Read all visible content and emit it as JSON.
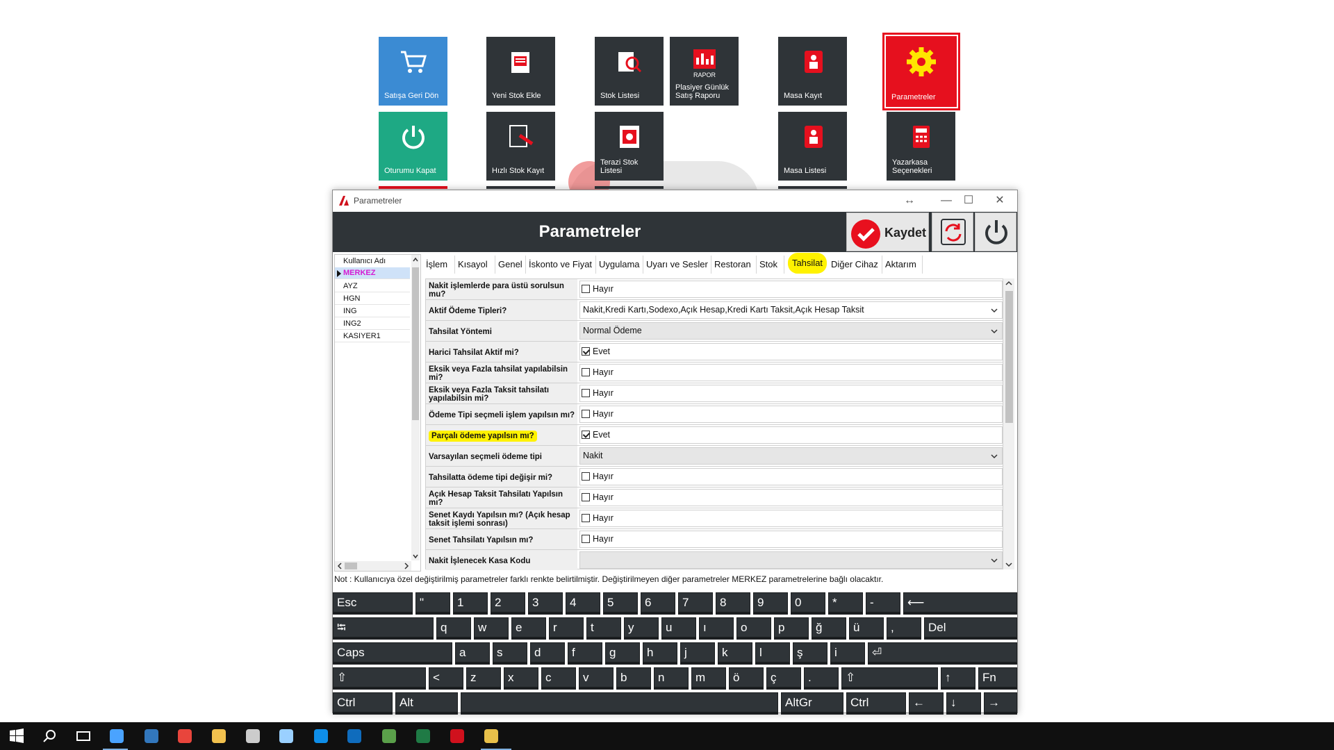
{
  "tiles": [
    {
      "label": "Satışa Geri Dön",
      "icon": "cart-icon"
    },
    {
      "label": "Yeni Stok Ekle",
      "icon": "new-stock-icon"
    },
    {
      "label": "Stok Listesi",
      "icon": "stock-search-icon"
    },
    {
      "label": "Plasiyer Günlük Satış Raporu",
      "icon": "report-icon",
      "badge": "RAPOR"
    },
    {
      "label": "Masa Kayıt",
      "icon": "table-register-icon"
    },
    {
      "label": "Parametreler",
      "icon": "gear-icon"
    },
    {
      "label": "Oturumu Kapat",
      "icon": "logout-icon"
    },
    {
      "label": "Hızlı Stok Kayıt",
      "icon": "quick-stock-icon"
    },
    {
      "label": "Terazi Stok Listesi",
      "icon": "scale-stock-icon"
    },
    {
      "label": "Masa Listesi",
      "icon": "table-list-icon"
    },
    {
      "label": "Yazarkasa Seçenekleri",
      "icon": "cash-register-icon"
    }
  ],
  "window": {
    "title": "Parametreler",
    "header_title": "Parametreler",
    "save_label": "Kaydet"
  },
  "users": {
    "header": "Kullanıcı Adı",
    "items": [
      "MERKEZ",
      "AYZ",
      "HGN",
      "ING",
      "ING2",
      "KASIYER1"
    ],
    "selected": "MERKEZ"
  },
  "tabs": [
    {
      "label": "İşlem"
    },
    {
      "label": "Kısayol"
    },
    {
      "label": "Genel"
    },
    {
      "label": "İskonto ve Fiyat"
    },
    {
      "label": "Uygulama"
    },
    {
      "label": "Uyarı ve Sesler"
    },
    {
      "label": "Restoran"
    },
    {
      "label": "Stok"
    },
    {
      "label": "Tahsilat",
      "active": true
    },
    {
      "label": "Diğer Cihaz"
    },
    {
      "label": "Aktarım"
    }
  ],
  "params": [
    {
      "label": "Nakit işlemlerde para üstü sorulsun mu?",
      "type": "check",
      "checked": false,
      "text": "Hayır"
    },
    {
      "label": "Aktif Ödeme Tipleri?",
      "type": "combo-white",
      "text": "Nakit,Kredi Kartı,Sodexo,Açık Hesap,Kredi Kartı Taksit,Açık Hesap Taksit"
    },
    {
      "label": "Tahsilat Yöntemi",
      "type": "combo",
      "text": "Normal Ödeme"
    },
    {
      "label": "Harici Tahsilat Aktif mi?",
      "type": "check",
      "checked": true,
      "text": "Evet"
    },
    {
      "label": "Eksik veya Fazla tahsilat yapılabilsin mi?",
      "type": "check",
      "checked": false,
      "text": "Hayır"
    },
    {
      "label": "Eksik veya Fazla Taksit tahsilatı yapılabilsin mi?",
      "type": "check",
      "checked": false,
      "text": "Hayır"
    },
    {
      "label": "Ödeme Tipi seçmeli işlem yapılsın mı?",
      "type": "check",
      "checked": false,
      "text": "Hayır"
    },
    {
      "label": "Parçalı ödeme yapılsın mı?",
      "type": "check",
      "checked": true,
      "text": "Evet",
      "highlight": true
    },
    {
      "label": "Varsayılan seçmeli ödeme tipi",
      "type": "combo",
      "text": "Nakit"
    },
    {
      "label": "Tahsilatta ödeme tipi değişir mi?",
      "type": "check",
      "checked": false,
      "text": "Hayır"
    },
    {
      "label": "Açık Hesap Taksit Tahsilatı Yapılsın mı?",
      "type": "check",
      "checked": false,
      "text": "Hayır"
    },
    {
      "label": "Senet Kaydı Yapılsın mı? (Açık hesap taksit işlemi sonrası)",
      "type": "check",
      "checked": false,
      "text": "Hayır"
    },
    {
      "label": "Senet Tahsilatı Yapılsın mı?",
      "type": "check",
      "checked": false,
      "text": "Hayır"
    },
    {
      "label": "Nakit İşlenecek Kasa Kodu",
      "type": "combo",
      "text": ""
    }
  ],
  "note": "Not : Kullanıcıya özel değiştirilmiş parametreler farklı renkte belirtilmiştir. Değiştirilmeyen diğer parametreler MERKEZ parametrelerine bağlı olacaktır.",
  "keyboard": {
    "rows": [
      [
        "Esc",
        "\"",
        "1",
        "2",
        "3",
        "4",
        "5",
        "6",
        "7",
        "8",
        "9",
        "0",
        "*",
        "-",
        "⟵"
      ],
      [
        "⭾",
        "q",
        "w",
        "e",
        "r",
        "t",
        "y",
        "u",
        "ı",
        "o",
        "p",
        "ğ",
        "ü",
        ",",
        "Del"
      ],
      [
        "Caps",
        "a",
        "s",
        "d",
        "f",
        "g",
        "h",
        "j",
        "k",
        "l",
        "ş",
        "i",
        "⏎"
      ],
      [
        "⇧",
        "<",
        "z",
        "x",
        "c",
        "v",
        "b",
        "n",
        "m",
        "ö",
        "ç",
        ".",
        "⇧",
        "↑",
        "Fn"
      ],
      [
        "Ctrl",
        "Alt",
        " ",
        "AltGr",
        "Ctrl",
        "←",
        "↓",
        "→"
      ]
    ]
  },
  "taskbar": {
    "icons": [
      "windows-start-icon",
      "search-icon",
      "task-view-icon",
      "app-pos-icon",
      "edge-icon",
      "chrome-icon",
      "file-explorer-icon",
      "app-tool-icon",
      "app-notes-icon",
      "teamviewer-icon",
      "outlook-icon",
      "notepad-icon",
      "excel-icon",
      "app-params-icon",
      "app-active-icon"
    ]
  },
  "colors": {
    "tile_dark": "#2f3438",
    "tile_blue": "#3b8bd3",
    "tile_green": "#1ea984",
    "tile_red": "#e6101e",
    "highlight": "#fff200",
    "selected_user": "#d51bd3"
  }
}
